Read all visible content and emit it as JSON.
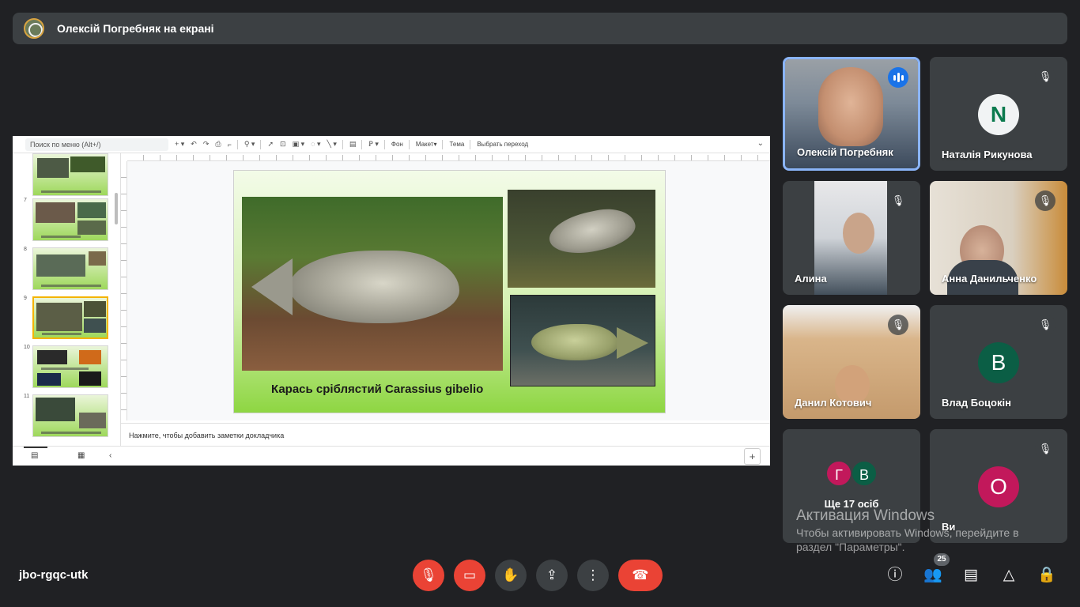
{
  "top_bar": {
    "title": "Олексій Погребняк на екрані"
  },
  "slides_app": {
    "menu_search_placeholder": "Поиск по меню (Alt+/)",
    "toolbar": {
      "background_label": "Фон",
      "layout_label": "Макет",
      "theme_label": "Тема",
      "transition_label": "Выбрать переход"
    },
    "thumbnails": [
      {
        "number": ""
      },
      {
        "number": "7"
      },
      {
        "number": "8"
      },
      {
        "number": "9"
      },
      {
        "number": "10"
      },
      {
        "number": "11"
      }
    ],
    "selected_slide": "9",
    "slide": {
      "caption": "Карась сріблястий Carassius gibelio"
    },
    "speaker_notes_placeholder": "Нажмите, чтобы добавить заметки докладчика"
  },
  "participants": [
    {
      "name": "Олексій Погребняк",
      "state": "speaking"
    },
    {
      "name": "Наталія Рикунова",
      "initial": "N",
      "avatar_color": "#f1f3f4",
      "state": "muted"
    },
    {
      "name": "Алина",
      "state": "muted"
    },
    {
      "name": "Анна Данильченко",
      "state": "muted"
    },
    {
      "name": "Данил Котович",
      "state": "muted"
    },
    {
      "name": "Влад Боцокін",
      "initial": "В",
      "avatar_color": "#0b5e45",
      "state": "muted"
    },
    {
      "name": "Ви",
      "initial": "О",
      "avatar_color": "#c2185b",
      "state": "muted"
    }
  ],
  "more_participants": {
    "label": "Ще 17 осіб",
    "initials": [
      {
        "initial": "Г",
        "color": "#c2185b"
      },
      {
        "initial": "В",
        "color": "#0b5e45"
      }
    ]
  },
  "windows_watermark": {
    "title": "Активация Windows",
    "line1": "Чтобы активировать Windows, перейдите в",
    "line2": "раздел \"Параметры\"."
  },
  "bottom_bar": {
    "meeting_code": "jbo-rgqc-utk",
    "participant_count": "25"
  },
  "colors": {
    "background": "#202124",
    "tile": "#3c4043",
    "danger": "#ea4335",
    "active_speaker_border": "#8ab4f8",
    "speaking_indicator": "#1a73e8"
  },
  "icons": {
    "mic": "mic-off-icon",
    "camera": "camera-off-icon",
    "hand": "hand-raise-icon",
    "present": "present-screen-icon",
    "more": "more-vert-icon",
    "hangup": "call-end-icon",
    "info": "info-icon",
    "people": "people-icon",
    "chat": "chat-icon",
    "activities": "activities-icon",
    "host_controls": "host-controls-icon"
  }
}
